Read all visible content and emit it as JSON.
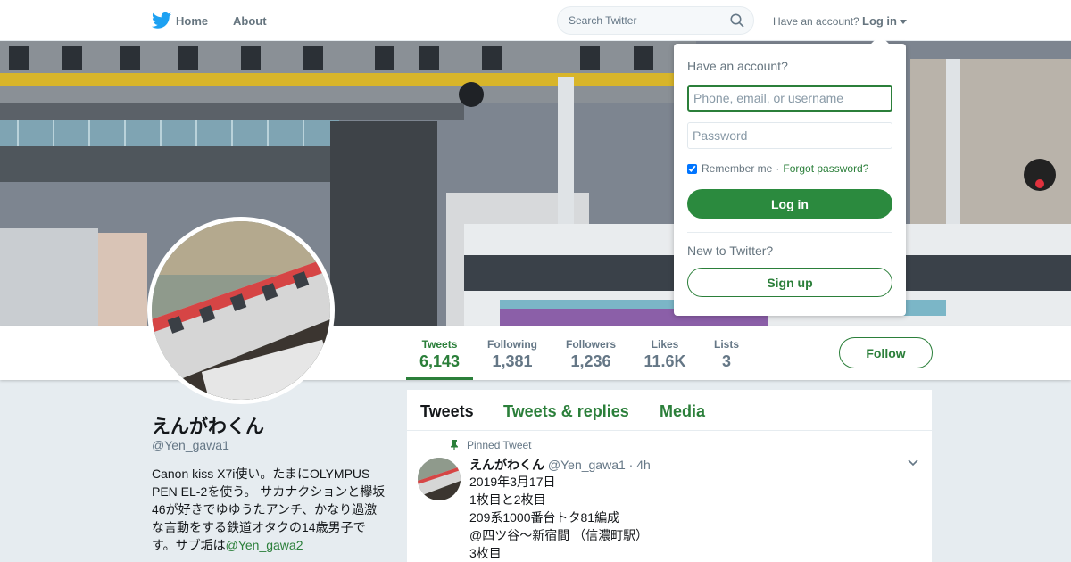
{
  "nav": {
    "logo_icon": "twitter-bird-icon",
    "home_label": "Home",
    "about_label": "About",
    "search_placeholder": "Search Twitter",
    "have_account": "Have an account?",
    "login_label": "Log in",
    "accent_color": "#2b7f3a"
  },
  "login_dropdown": {
    "title": "Have an account?",
    "username_placeholder": "Phone, email, or username",
    "password_placeholder": "Password",
    "remember_label": "Remember me",
    "separator": "·",
    "forgot_label": "Forgot password?",
    "login_button": "Log in",
    "new_label": "New to Twitter?",
    "signup_button": "Sign up"
  },
  "profile_nav": {
    "stats": [
      {
        "label": "Tweets",
        "value": "6,143"
      },
      {
        "label": "Following",
        "value": "1,381"
      },
      {
        "label": "Followers",
        "value": "1,236"
      },
      {
        "label": "Likes",
        "value": "11.6K"
      },
      {
        "label": "Lists",
        "value": "3"
      }
    ],
    "follow_button": "Follow"
  },
  "profile": {
    "name": "えんがわくん",
    "handle": "@Yen_gawa1",
    "bio_text": "Canon kiss X7i使い。たまにOLYMPUS PEN EL-2を使う。 サカナクションと欅坂46が好きでゆゆうたアンチ、かなり過激な言動をする鉄道オタクの14歳男子です。サブ垢は",
    "bio_link": "@Yen_gawa2"
  },
  "timeline": {
    "tabs": [
      "Tweets",
      "Tweets & replies",
      "Media"
    ],
    "pinned_label": "Pinned Tweet",
    "tweet": {
      "name": "えんがわくん",
      "handle": "@Yen_gawa1",
      "time": "· 4h",
      "lines": [
        "2019年3月17日",
        "1枚目と2枚目",
        "209系1000番台トタ81編成",
        "@四ツ谷〜新宿間 （信濃町駅）",
        "3枚目"
      ]
    }
  }
}
